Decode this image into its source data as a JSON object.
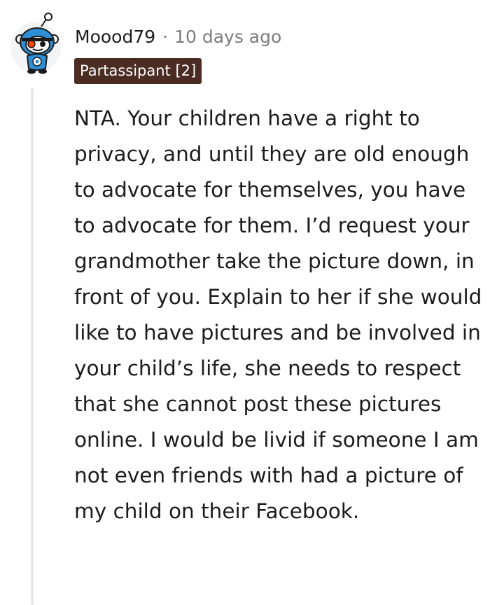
{
  "comment": {
    "author": "Moood79",
    "separator": "·",
    "timestamp": "10 days ago",
    "flair": "Partassipant [2]",
    "avatar_icon": "snoo-avatar-icon",
    "text": "NTA. Your children have a right to privacy, and until they are old enough to advocate for themselves, you have to advocate for them. I’d request your grandmother take the picture down, in front of you. Explain to her if she would like to have pictures and be involved in your child’s life, she needs to respect that she cannot post these pictures online. I would be livid if someone I am not even friends with had a picture of my child on their Facebook."
  },
  "colors": {
    "flair_background": "#4b2c23",
    "flair_text": "#ffffff",
    "meta_gray": "#7c7c7c",
    "text": "#1c1c1c",
    "thread_line": "#e8e8e8",
    "avatar_blue": "#2f8fd6"
  }
}
